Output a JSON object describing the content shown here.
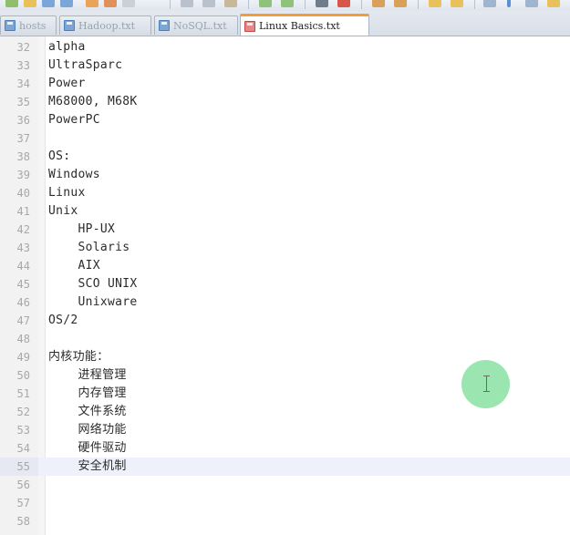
{
  "tabs": [
    {
      "label": "hosts",
      "icon": "disk-icon",
      "active": false
    },
    {
      "label": "Hadoop.txt",
      "icon": "disk-icon",
      "active": false
    },
    {
      "label": "NoSQL.txt",
      "icon": "disk-icon",
      "active": false
    },
    {
      "label": "Linux Basics.txt",
      "icon": "disk-icon",
      "active": true
    }
  ],
  "editor": {
    "current_line": 55,
    "lines": [
      {
        "n": "32",
        "text": "alpha"
      },
      {
        "n": "33",
        "text": "UltraSparc"
      },
      {
        "n": "34",
        "text": "Power"
      },
      {
        "n": "35",
        "text": "M68000, M68K"
      },
      {
        "n": "36",
        "text": "PowerPC"
      },
      {
        "n": "37",
        "text": ""
      },
      {
        "n": "38",
        "text": "OS:"
      },
      {
        "n": "39",
        "text": "Windows"
      },
      {
        "n": "40",
        "text": "Linux"
      },
      {
        "n": "41",
        "text": "Unix"
      },
      {
        "n": "42",
        "text": "    HP-UX"
      },
      {
        "n": "43",
        "text": "    Solaris"
      },
      {
        "n": "44",
        "text": "    AIX"
      },
      {
        "n": "45",
        "text": "    SCO UNIX"
      },
      {
        "n": "46",
        "text": "    Unixware"
      },
      {
        "n": "47",
        "text": "OS/2"
      },
      {
        "n": "48",
        "text": ""
      },
      {
        "n": "49",
        "text": "内核功能："
      },
      {
        "n": "50",
        "text": "    进程管理"
      },
      {
        "n": "51",
        "text": "    内存管理"
      },
      {
        "n": "52",
        "text": "    文件系统"
      },
      {
        "n": "53",
        "text": "    网络功能"
      },
      {
        "n": "54",
        "text": "    硬件驱动"
      },
      {
        "n": "55",
        "text": "    安全机制"
      },
      {
        "n": "56",
        "text": ""
      },
      {
        "n": "57",
        "text": ""
      },
      {
        "n": "58",
        "text": ""
      }
    ]
  },
  "colors": {
    "active_tab_accent": "#f39c3c",
    "current_line_bg": "#eef0fa",
    "cursor_halo": "#78dc96"
  }
}
